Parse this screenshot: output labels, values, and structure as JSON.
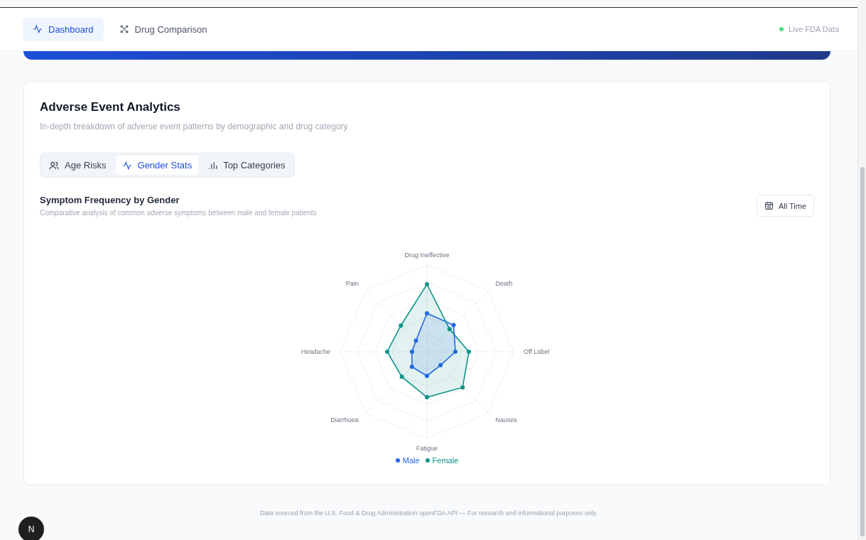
{
  "nav": {
    "tabs": [
      {
        "label": "Dashboard",
        "selected": true
      },
      {
        "label": "Drug Comparison",
        "selected": false
      }
    ],
    "status": {
      "label": "Live FDA Data",
      "color": "#4ade80"
    }
  },
  "analytics": {
    "title": "Adverse Event Analytics",
    "subtitle": "In-depth breakdown of adverse event patterns by demographic and drug category",
    "tabs": [
      {
        "label": "Age Risks",
        "selected": false
      },
      {
        "label": "Gender Stats",
        "selected": true
      },
      {
        "label": "Top Categories",
        "selected": false
      }
    ],
    "chart": {
      "title": "Symptom Frequency by Gender",
      "subtitle": "Comparative analysis of common adverse symptoms between male and female patients",
      "range_button": "All Time",
      "axes": [
        "Drug Ineffective",
        "Death",
        "Off Label",
        "Nauses",
        "Fatigue",
        "Diarrhoea",
        "Headache",
        "Pain"
      ],
      "legend": [
        {
          "label": "Male",
          "color": "#2563eb"
        },
        {
          "label": "Female",
          "color": "#0d9488"
        }
      ]
    }
  },
  "footer": "Data sourced from the U.S. Food & Drug Administration openFDA API — For research and informational purposes only.",
  "dev_badge": "N"
}
